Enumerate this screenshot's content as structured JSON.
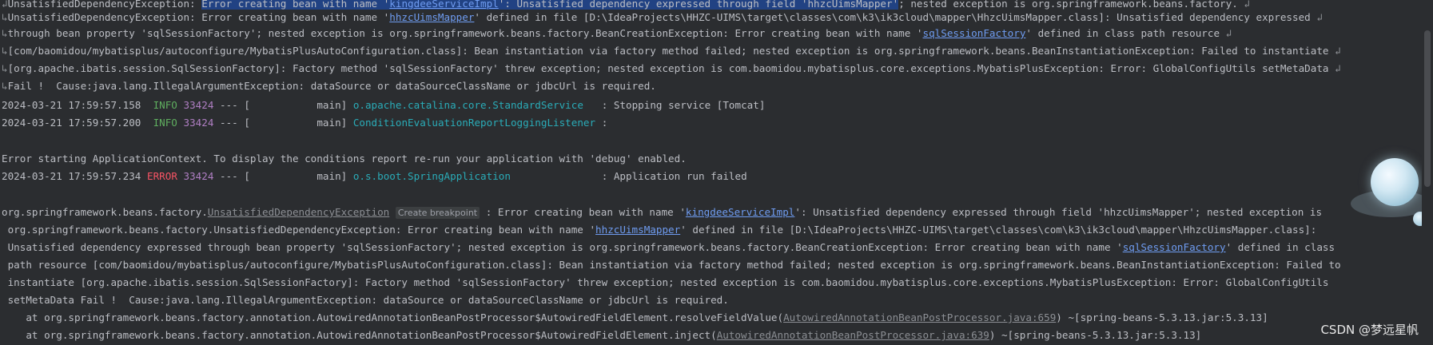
{
  "console": {
    "lines": [
      {
        "kind": "wrap-top",
        "pre": "Unsatisfied",
        "text1": "DependencyException: ",
        "sel1": "Error creating bean with name '",
        "sel_link": "kingdeeServiceImpl",
        "sel2": "': Unsatisfied dependency expressed through field 'hhzcUimsMapper'",
        "text2": "; nested exception is org.springframework.beans.factory."
      },
      {
        "text": "UnsatisfiedDependencyException: Error creating bean with name '",
        "link": "hhzcUimsMapper",
        "text_after": "' defined in file [D:\\IdeaProjects\\HHZC-UIMS\\target\\classes\\com\\k3\\ik3cloud\\mapper\\HhzcUimsMapper.class]: Unsatisfied dependency expressed"
      },
      {
        "text": "through bean property 'sqlSessionFactory'; nested exception is org.springframework.beans.factory.BeanCreationException: Error creating bean with name '",
        "link": "sqlSessionFactory",
        "text_after": "' defined in class path resource"
      },
      {
        "text": "[com/baomidou/mybatisplus/autoconfigure/MybatisPlusAutoConfiguration.class]: Bean instantiation via factory method failed; nested exception is org.springframework.beans.BeanInstantiationException: Failed to instantiate"
      },
      {
        "text": "[org.apache.ibatis.session.SqlSessionFactory]: Factory method 'sqlSessionFactory' threw exception; nested exception is com.baomidou.mybatisplus.core.exceptions.MybatisPlusException: Error: GlobalConfigUtils setMetaData"
      },
      {
        "text": "Fail !  Cause:java.lang.IllegalArgumentException: dataSource or dataSourceClassName or jdbcUrl is required."
      }
    ],
    "log": [
      {
        "ts": "2024-03-21 17:59:57.158",
        "level": "INFO",
        "pid": "33424",
        "sep": " --- [           main] ",
        "logger": "o.apache.catalina.core.StandardService   ",
        "msg": ": Stopping service [Tomcat]"
      },
      {
        "ts": "2024-03-21 17:59:57.200",
        "level": "INFO",
        "pid": "33424",
        "sep": " --- [           main] ",
        "logger": "ConditionEvaluationReportLoggingListener ",
        "msg": ":"
      }
    ],
    "error_context": "Error starting ApplicationContext. To display the conditions report re-run your application with 'debug' enabled.",
    "error_log": {
      "ts": "2024-03-21 17:59:57.234",
      "level": "ERROR",
      "pid": "33424",
      "sep": " --- [           main] ",
      "logger": "o.s.boot.SpringApplication               ",
      "msg": ": Application run failed"
    },
    "exception": {
      "pkg": "org.springframework.beans.factory.",
      "cls": "UnsatisfiedDependencyException",
      "breakpoint_hint": "Create breakpoint",
      "l1_a": " : Error creating bean with name '",
      "l1_link": "kingdeeServiceImpl",
      "l1_b": "': Unsatisfied dependency expressed through field 'hhzcUimsMapper'; nested exception is",
      "l2_a": " org.springframework.beans.factory.UnsatisfiedDependencyException: Error creating bean with name '",
      "l2_link": "hhzcUimsMapper",
      "l2_b": "' defined in file [D:\\IdeaProjects\\HHZC-UIMS\\target\\classes\\com\\k3\\ik3cloud\\mapper\\HhzcUimsMapper.class]:",
      "l3_a": " Unsatisfied dependency expressed through bean property 'sqlSessionFactory'; nested exception is org.springframework.beans.factory.BeanCreationException: Error creating bean with name '",
      "l3_link": "sqlSessionFactory",
      "l3_b": "' defined in class",
      "l4": " path resource [com/baomidou/mybatisplus/autoconfigure/MybatisPlusAutoConfiguration.class]: Bean instantiation via factory method failed; nested exception is org.springframework.beans.BeanInstantiationException: Failed to",
      "l5": " instantiate [org.apache.ibatis.session.SqlSessionFactory]: Factory method 'sqlSessionFactory' threw exception; nested exception is com.baomidou.mybatisplus.core.exceptions.MybatisPlusException: Error: GlobalConfigUtils",
      "l6": " setMetaData Fail !  Cause:java.lang.IllegalArgumentException: dataSource or dataSourceClassName or jdbcUrl is required."
    },
    "stack": [
      {
        "pre": "    at org.springframework.beans.factory.annotation.AutowiredAnnotationBeanPostProcessor$AutowiredFieldElement.resolveFieldValue(",
        "link": "AutowiredAnnotationBeanPostProcessor.java:659",
        "post": ") ~[spring-beans-5.3.13.jar:5.3.13]"
      },
      {
        "pre": "    at org.springframework.beans.factory.annotation.AutowiredAnnotationBeanPostProcessor$AutowiredFieldElement.inject(",
        "link": "AutowiredAnnotationBeanPostProcessor.java:639",
        "post": ") ~[spring-beans-5.3.13.jar:5.3.13]"
      }
    ]
  },
  "watermark": "CSDN @梦远星帆",
  "colors": {
    "background": "#2b2d30",
    "text": "#bcbec4",
    "link": "#6f9cf1",
    "info": "#5fae5f",
    "error": "#f75464",
    "logger": "#2aacb8",
    "pid": "#b07fc4",
    "selection": "#214283"
  }
}
